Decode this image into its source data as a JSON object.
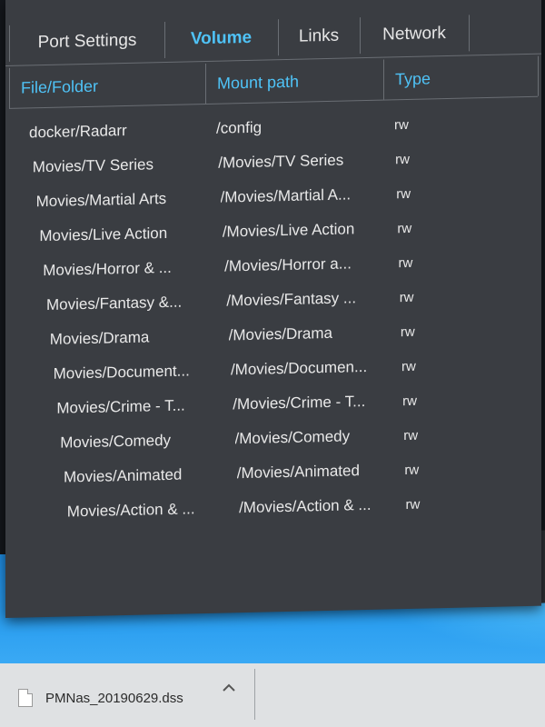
{
  "tabs": [
    {
      "label": "Port Settings",
      "active": false
    },
    {
      "label": "Volume",
      "active": true
    },
    {
      "label": "Links",
      "active": false
    },
    {
      "label": "Network",
      "active": false
    }
  ],
  "table": {
    "headers": [
      "File/Folder",
      "Mount path",
      "Type"
    ],
    "rows": [
      {
        "folder": "docker/Radarr",
        "path": "/config",
        "type": "rw"
      },
      {
        "folder": "Movies/TV Series",
        "path": "/Movies/TV Series",
        "type": "rw"
      },
      {
        "folder": "Movies/Martial Arts",
        "path": "/Movies/Martial A...",
        "type": "rw"
      },
      {
        "folder": "Movies/Live Action",
        "path": "/Movies/Live Action",
        "type": "rw"
      },
      {
        "folder": "Movies/Horror & ...",
        "path": "/Movies/Horror a...",
        "type": "rw"
      },
      {
        "folder": "Movies/Fantasy &...",
        "path": "/Movies/Fantasy ...",
        "type": "rw"
      },
      {
        "folder": "Movies/Drama",
        "path": "/Movies/Drama",
        "type": "rw"
      },
      {
        "folder": "Movies/Document...",
        "path": "/Movies/Documen...",
        "type": "rw"
      },
      {
        "folder": "Movies/Crime - T...",
        "path": "/Movies/Crime - T...",
        "type": "rw"
      },
      {
        "folder": "Movies/Comedy",
        "path": "/Movies/Comedy",
        "type": "rw"
      },
      {
        "folder": "Movies/Animated",
        "path": "/Movies/Animated",
        "type": "rw"
      },
      {
        "folder": "Movies/Action & ...",
        "path": "/Movies/Action & ...",
        "type": "rw"
      }
    ]
  },
  "download_bar": {
    "file_name": "PMNas_20190629.dss",
    "icon": "file-icon",
    "menu_icon": "chevron-up-icon"
  },
  "colors": {
    "accent": "#4fc3f7",
    "window_bg": "#3a3d42",
    "desktop_blue": "#2a9ef0"
  }
}
